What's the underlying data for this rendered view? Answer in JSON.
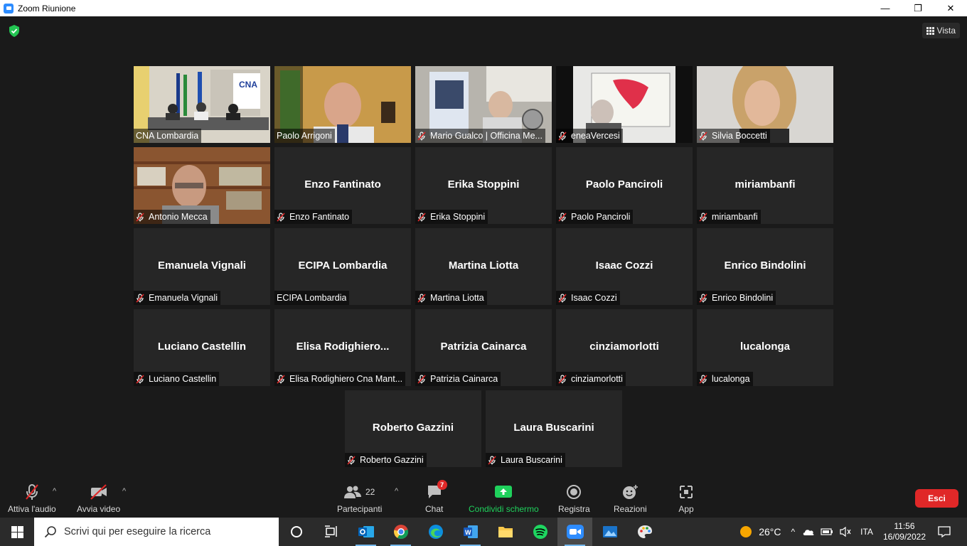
{
  "window": {
    "title": "Zoom Riunione",
    "controls": [
      "—",
      "❐",
      "✕"
    ]
  },
  "header": {
    "view_label": "Vista"
  },
  "participants": [
    {
      "display": "",
      "name": "CNA Lombardia",
      "muted": false,
      "video": "room"
    },
    {
      "display": "",
      "name": "Paolo Arrigoni",
      "muted": false,
      "video": "speaker",
      "active_speaker": true
    },
    {
      "display": "",
      "name": "Mario Gualco | Officina Me...",
      "muted": true,
      "video": "office"
    },
    {
      "display": "",
      "name": "eneaVercesi",
      "muted": true,
      "video": "map"
    },
    {
      "display": "",
      "name": "Silvia Boccetti",
      "muted": true,
      "video": "woman"
    },
    {
      "display": "",
      "name": "Antonio Mecca",
      "muted": true,
      "video": "bookshelf"
    },
    {
      "display": "Enzo Fantinato",
      "name": "Enzo Fantinato",
      "muted": true
    },
    {
      "display": "Erika Stoppini",
      "name": "Erika Stoppini",
      "muted": true
    },
    {
      "display": "Paolo Panciroli",
      "name": "Paolo Panciroli",
      "muted": true
    },
    {
      "display": "miriambanfi",
      "name": "miriambanfi",
      "muted": true
    },
    {
      "display": "Emanuela Vignali",
      "name": "Emanuela Vignali",
      "muted": true
    },
    {
      "display": "ECIPA Lombardia",
      "name": "ECIPA Lombardia",
      "muted": false
    },
    {
      "display": "Martina Liotta",
      "name": "Martina Liotta",
      "muted": true
    },
    {
      "display": "Isaac Cozzi",
      "name": "Isaac Cozzi",
      "muted": true
    },
    {
      "display": "Enrico Bindolini",
      "name": "Enrico Bindolini",
      "muted": true
    },
    {
      "display": "Luciano Castellin",
      "name": "Luciano Castellin",
      "muted": true
    },
    {
      "display": "Elisa  Rodighiero...",
      "name": "Elisa Rodighiero Cna Mant...",
      "muted": true
    },
    {
      "display": "Patrizia Cainarca",
      "name": "Patrizia Cainarca",
      "muted": true
    },
    {
      "display": "cinziamorlotti",
      "name": "cinziamorlotti",
      "muted": true
    },
    {
      "display": "lucalonga",
      "name": "lucalonga",
      "muted": true
    },
    {
      "display": "Roberto Gazzini",
      "name": "Roberto Gazzini",
      "muted": true
    },
    {
      "display": "Laura Buscarini",
      "name": "Laura Buscarini",
      "muted": true
    }
  ],
  "toolbar": {
    "audio_label": "Attiva l'audio",
    "video_label": "Avvia video",
    "participants_label": "Partecipanti",
    "participants_count": "22",
    "chat_label": "Chat",
    "chat_badge": "7",
    "share_label": "Condividi schermo",
    "record_label": "Registra",
    "reactions_label": "Reazioni",
    "apps_label": "App",
    "leave_label": "Esci",
    "share_color": "#1fd15c",
    "leave_color": "#e02828"
  },
  "taskbar": {
    "search_placeholder": "Scrivi qui per eseguire la ricerca",
    "weather": "26°C",
    "language": "ITA",
    "time": "11:56",
    "date": "16/09/2022"
  }
}
